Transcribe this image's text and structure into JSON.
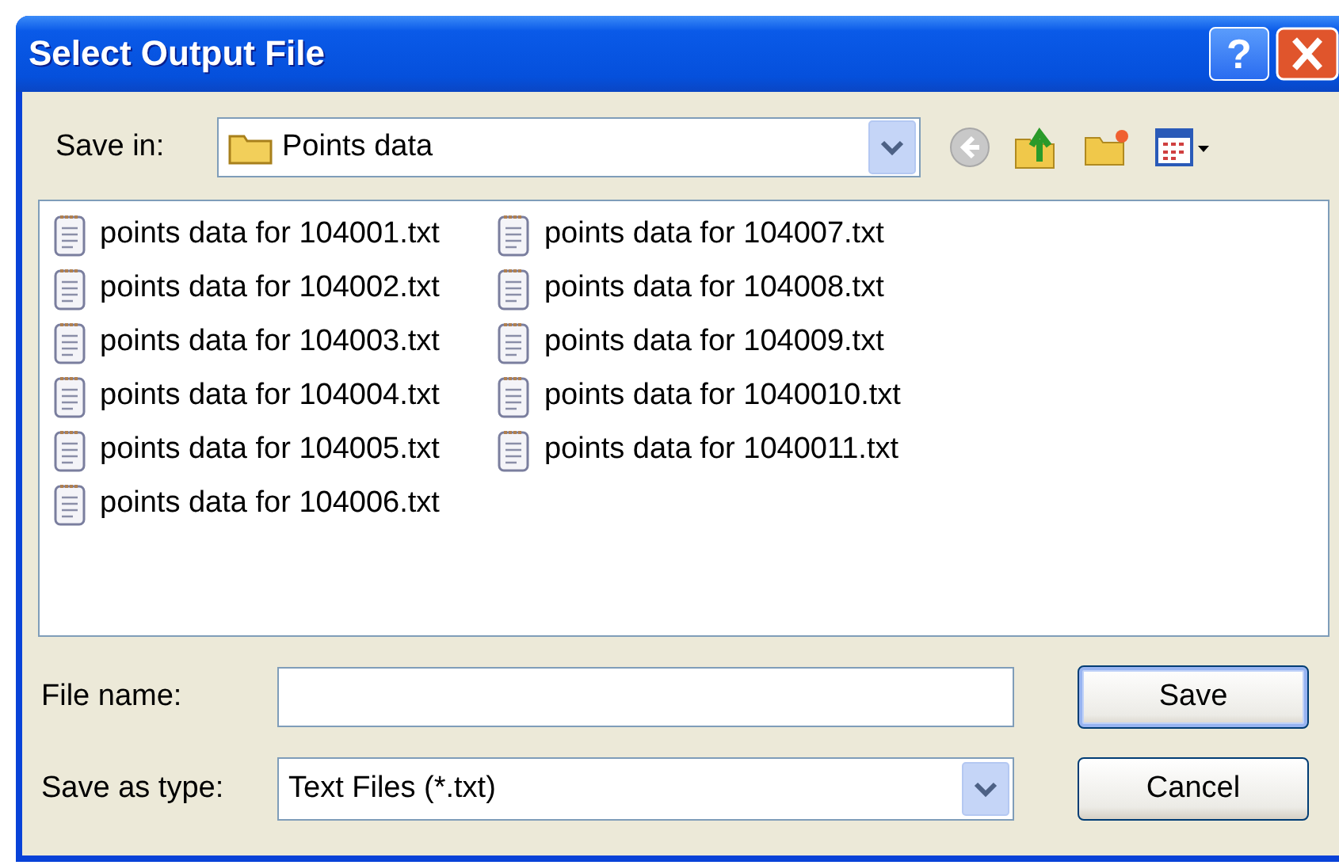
{
  "window": {
    "title": "Select Output File",
    "help_button": "?"
  },
  "save_in": {
    "label": "Save in:",
    "value": "Points data"
  },
  "files": [
    "points data for 104001.txt",
    "points data for 104002.txt",
    "points data for 104003.txt",
    "points data for 104004.txt",
    "points data for 104005.txt",
    "points data for 104006.txt",
    "points data for 104007.txt",
    "points data for 104008.txt",
    "points data for 104009.txt",
    "points data for 1040010.txt",
    "points data for 1040011.txt"
  ],
  "file_name": {
    "label": "File name:"
  },
  "save_as_type": {
    "label": "Save as type:",
    "value": "Text Files (*.txt)"
  },
  "buttons": [
    {
      "label": "Save",
      "default": true
    },
    {
      "label": "Cancel",
      "default": false
    }
  ]
}
